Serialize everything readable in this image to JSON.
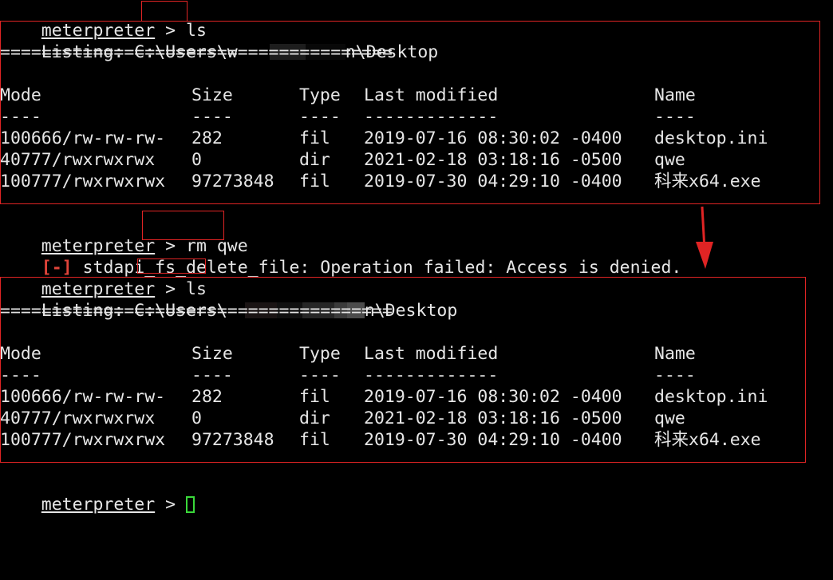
{
  "colors": {
    "background": "#000000",
    "text": "#e6e6e6",
    "error": "#e0443a",
    "annotation": "#e02424",
    "cursor": "#3ad93a"
  },
  "prompt": {
    "word": "meterpreter",
    "symbol": ">"
  },
  "commands": {
    "first": "ls",
    "second": "rm qwe",
    "third": "ls"
  },
  "listing1": {
    "label": "Listing: C:\\Users\\",
    "user_start": "w",
    "user_end": "n\\Desktop",
    "rule": "======================================"
  },
  "listing2": {
    "label": "Listing: C:\\Users\\",
    "user_end": "n\\Desktop",
    "rule": "======================================"
  },
  "table": {
    "headers": {
      "mode": "Mode",
      "size": "Size",
      "type": "Type",
      "modified": "Last modified",
      "name": "Name"
    },
    "dashes": {
      "mode": "----",
      "size": "----",
      "type": "----",
      "modified": "-------------",
      "name": "----"
    },
    "rows": [
      {
        "mode": "100666/rw-rw-rw-",
        "size": "282",
        "type": "fil",
        "modified": "2019-07-16 08:30:02 -0400",
        "name": "desktop.ini"
      },
      {
        "mode": "40777/rwxrwxrwx",
        "size": "0",
        "type": "dir",
        "modified": "2021-02-18 03:18:16 -0500",
        "name": "qwe"
      },
      {
        "mode": "100777/rwxrwxrwx",
        "size": "97273848",
        "type": "fil",
        "modified": "2019-07-30 04:29:10 -0400",
        "name": "科来x64.exe"
      }
    ]
  },
  "error": {
    "marker": "[-]",
    "message": " stdapi_fs_delete_file: Operation failed: Access is denied."
  }
}
